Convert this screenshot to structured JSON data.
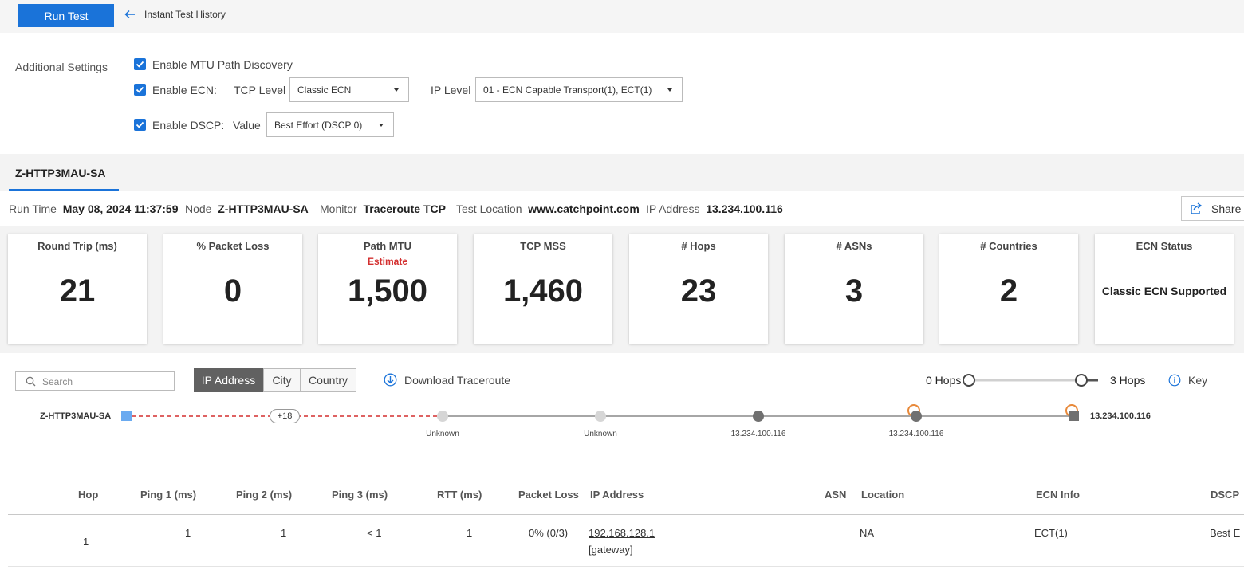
{
  "toolbar": {
    "run_test_label": "Run Test",
    "history_label": "Instant Test History"
  },
  "settings": {
    "label": "Additional Settings",
    "mtu": {
      "label": "Enable MTU Path Discovery",
      "checked": true
    },
    "ecn": {
      "label": "Enable ECN:",
      "checked": true,
      "tcp_level_label": "TCP Level",
      "tcp_level_value": "Classic ECN",
      "ip_level_label": "IP Level",
      "ip_level_value": "01 - ECN Capable Transport(1), ECT(1)"
    },
    "dscp": {
      "label": "Enable DSCP:",
      "checked": true,
      "value_label": "Value",
      "value": "Best Effort (DSCP 0)"
    }
  },
  "tab": {
    "label": "Z-HTTP3MAU-SA"
  },
  "info": {
    "run_time_label": "Run Time",
    "run_time": "May 08, 2024 11:37:59",
    "node_label": "Node",
    "node": "Z-HTTP3MAU-SA",
    "monitor_label": "Monitor",
    "monitor": "Traceroute TCP",
    "location_label": "Test Location",
    "location": "www.catchpoint.com",
    "ip_label": "IP Address",
    "ip": "13.234.100.116",
    "share_label": "Share"
  },
  "metrics": [
    {
      "title": "Round Trip (ms)",
      "value": "21"
    },
    {
      "title": "% Packet Loss",
      "value": "0"
    },
    {
      "title": "Path MTU",
      "subtitle": "Estimate",
      "value": "1,500"
    },
    {
      "title": "TCP MSS",
      "value": "1,460"
    },
    {
      "title": "# Hops",
      "value": "23"
    },
    {
      "title": "# ASNs",
      "value": "3"
    },
    {
      "title": "# Countries",
      "value": "2"
    },
    {
      "title": "ECN Status",
      "value": "Classic ECN Supported"
    }
  ],
  "trace_controls": {
    "search_placeholder": "Search",
    "segments": [
      "IP Address",
      "City",
      "Country"
    ],
    "active_segment": "IP Address",
    "download_label": "Download Traceroute",
    "hops_min_label": "0 Hops",
    "hops_max_label": "3 Hops",
    "key_label": "Key"
  },
  "trace": {
    "source": "Z-HTTP3MAU-SA",
    "collapsed_label": "+18",
    "destination": "13.234.100.116",
    "nodes": [
      "Unknown",
      "Unknown",
      "13.234.100.116",
      "13.234.100.116"
    ],
    "colors": {
      "source": "#6aaaf0",
      "dashed_line": "#d32f2f",
      "unknown_node": "#d6d6d6",
      "known_node": "#707070",
      "marker": "#e8893a"
    }
  },
  "table": {
    "headers": [
      "Hop",
      "Ping 1 (ms)",
      "Ping 2 (ms)",
      "Ping 3 (ms)",
      "RTT (ms)",
      "Packet Loss",
      "IP Address",
      "ASN",
      "Location",
      "ECN Info",
      "DSCP"
    ],
    "rows": [
      {
        "hop": "1",
        "ping1": "1",
        "ping2": "1",
        "ping3": "< 1",
        "rtt": "1",
        "loss": "0% (0/3)",
        "ip": "192.168.128.1",
        "ip_note": "[gateway]",
        "asn": "",
        "location": "NA",
        "ecn": "ECT(1)",
        "dscp": "Best E"
      }
    ]
  }
}
